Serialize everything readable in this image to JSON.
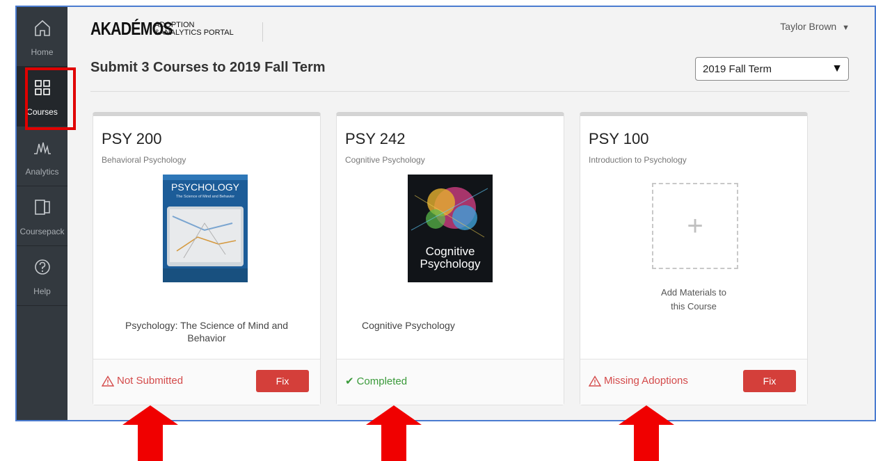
{
  "sidebar": {
    "items": [
      {
        "label": "Home",
        "icon": "home-icon"
      },
      {
        "label": "Courses",
        "icon": "grid-icon"
      },
      {
        "label": "Analytics",
        "icon": "analytics-icon"
      },
      {
        "label": "Coursepack",
        "icon": "coursepack-icon"
      },
      {
        "label": "Help",
        "icon": "help-icon"
      }
    ],
    "active": "Courses"
  },
  "header": {
    "logo_main": "AKADÉMOS",
    "logo_sub_line1": "ADOPTION",
    "logo_sub_line2": "&ANALYTICS PORTAL",
    "user_name": "Taylor Brown",
    "user_caret": "▼",
    "title": "Submit 3 Courses to 2019 Fall Term",
    "term_selected": "2019 Fall Term",
    "term_caret": "▼"
  },
  "cards": [
    {
      "code": "PSY 200",
      "name": "Behavioral Psychology",
      "book_title": "Psychology: The Science of Mind and Behavior",
      "cover_title": "PSYCHOLOGY",
      "cover_subtitle": "The Science of Mind and Behavior",
      "status": "Not Submitted",
      "status_type": "error",
      "action": "Fix"
    },
    {
      "code": "PSY 242",
      "name": "Cognitive Psychology",
      "book_title": "Cognitive Psychology",
      "cover_title_1": "Cognitive",
      "cover_title_2": "Psychology",
      "status": "Completed",
      "status_type": "success"
    },
    {
      "code": "PSY 100",
      "name": "Introduction to Psychology",
      "add_label": "Add Materials to this Course",
      "add_symbol": "+",
      "status": "Missing Adoptions",
      "status_type": "error",
      "action": "Fix"
    }
  ],
  "colors": {
    "sidebar_bg": "#33393f",
    "error": "#d44a4a",
    "success": "#3a9a3a",
    "fix_button": "#d43f3a",
    "annotation_red": "#e00000"
  }
}
